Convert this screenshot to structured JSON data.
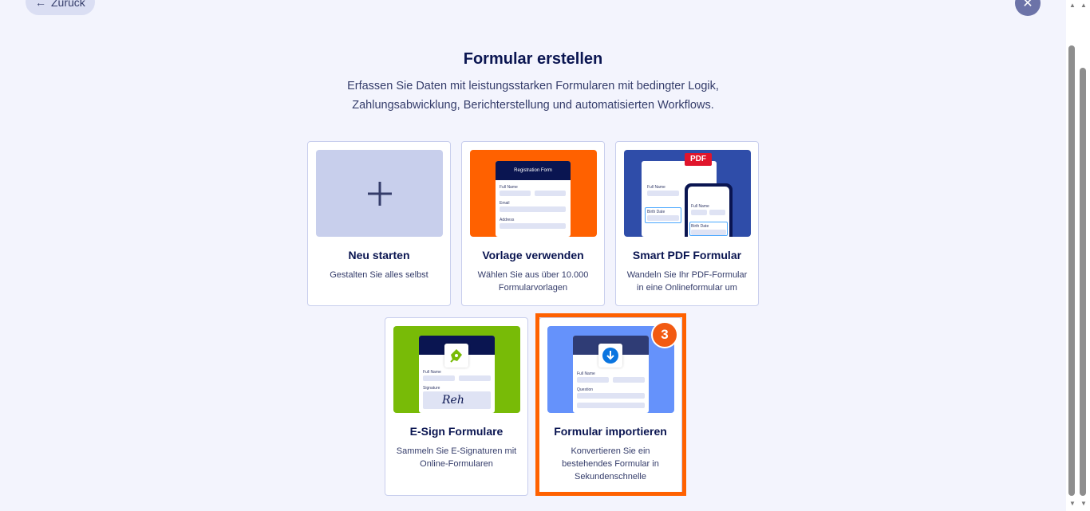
{
  "nav": {
    "back_label": "Zurück",
    "back_icon": "arrow-left-icon",
    "close_icon": "close-icon"
  },
  "header": {
    "title": "Formular erstellen",
    "subtitle": "Erfassen Sie Daten mit leistungsstarken Formularen mit bedingter Logik, Zahlungsabwicklung, Berichterstellung und automatisierten Workflows."
  },
  "cards": [
    {
      "title": "Neu starten",
      "desc": "Gestalten Sie alles selbst"
    },
    {
      "title": "Vorlage verwenden",
      "desc": "Wählen Sie aus über 10.000 Formularvorlagen",
      "thumb": {
        "header": "Registration Form",
        "f1": "Full Name",
        "f2": "Email",
        "f3": "Address"
      }
    },
    {
      "title": "Smart PDF Formular",
      "desc": "Wandeln Sie Ihr PDF-Formular in eine Onlineformular um",
      "thumb": {
        "pdf": "PDF",
        "f1": "Full Name",
        "f2": "Birth Date",
        "f3": "Full Name",
        "f4": "Birth Date"
      }
    },
    {
      "title": "E-Sign Formulare",
      "desc": "Sammeln Sie E-Signaturen mit Online-Formularen",
      "thumb": {
        "f1": "Full Name",
        "f2": "Signature",
        "sig": "Reh"
      }
    },
    {
      "title": "Formular importieren",
      "desc": "Konvertieren Sie ein bestehendes Formular in Sekundenschnelle",
      "thumb": {
        "f1": "Full Name",
        "f2": "Question"
      }
    }
  ],
  "step_badge": "3",
  "colors": {
    "accent": "#ff6100",
    "navy": "#0a1551",
    "orange": "#ff6100",
    "green": "#78bb07",
    "blue": "#6592fb",
    "pdf_blue": "#2f4da9"
  }
}
